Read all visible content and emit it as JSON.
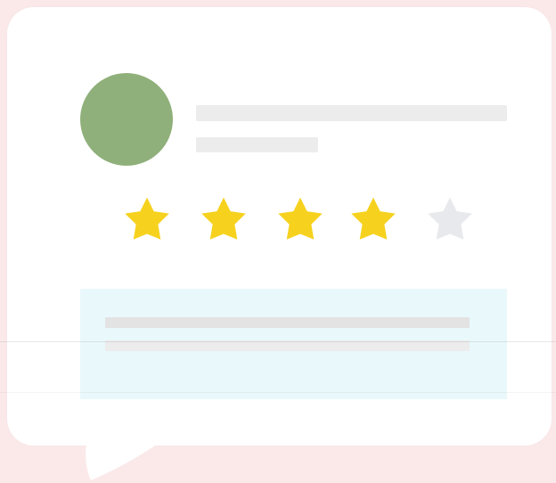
{
  "illustration": {
    "colors": {
      "background": "#fbe9ea",
      "bubble": "#ffffff",
      "avatar": "#8fb07a",
      "star_filled": "#f6d21f",
      "star_empty": "#e8e9ec",
      "comment_box": "#e9f8fb",
      "placeholder_line": "#ececec"
    },
    "rating": {
      "filled": 4,
      "total": 5
    }
  }
}
